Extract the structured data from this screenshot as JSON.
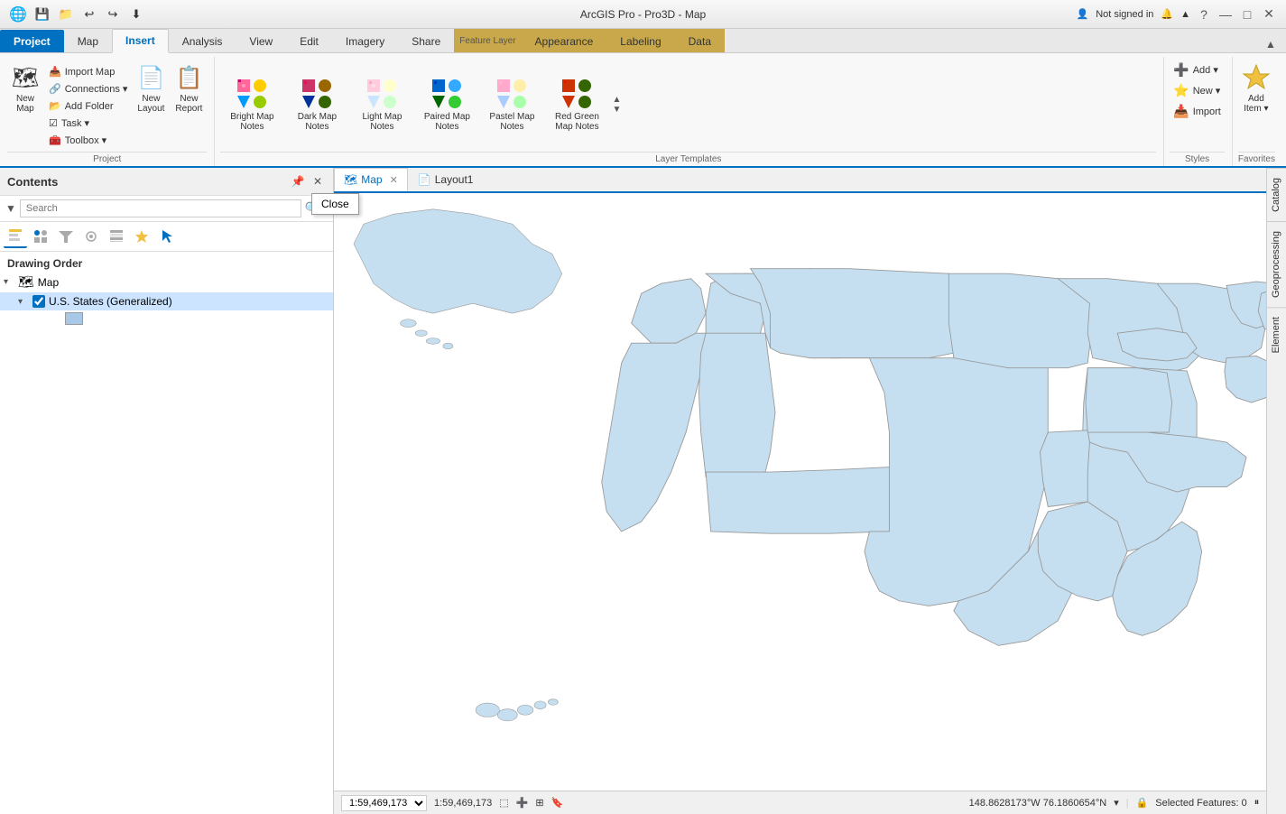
{
  "app": {
    "title": "ArcGIS Pro - Pro3D - Map",
    "feature_layer_title": "Feature Layer"
  },
  "titlebar": {
    "close_btn": "✕",
    "minimize_btn": "—",
    "maximize_btn": "□",
    "help_btn": "?"
  },
  "quickaccess": {
    "btns": [
      "💾",
      "📁",
      "↩",
      "↪",
      "⬇"
    ]
  },
  "ribbon": {
    "tabs": [
      {
        "label": "Project",
        "type": "project"
      },
      {
        "label": "Map",
        "type": "normal"
      },
      {
        "label": "Insert",
        "type": "active"
      },
      {
        "label": "Analysis",
        "type": "normal"
      },
      {
        "label": "View",
        "type": "normal"
      },
      {
        "label": "Edit",
        "type": "normal"
      },
      {
        "label": "Imagery",
        "type": "normal"
      },
      {
        "label": "Share",
        "type": "normal"
      },
      {
        "label": "Appearance",
        "type": "contextual"
      },
      {
        "label": "Labeling",
        "type": "contextual"
      },
      {
        "label": "Data",
        "type": "contextual"
      }
    ],
    "feature_layer_label": "Feature Layer",
    "groups": {
      "project": {
        "label": "Project",
        "items": [
          {
            "label": "New\nMap",
            "icon": "🗺"
          },
          {
            "label": "New\nLayout",
            "icon": "📄"
          },
          {
            "label": "New\nReport",
            "icon": "📋"
          }
        ],
        "small_items": [
          {
            "label": "Import Map"
          },
          {
            "label": "Connections"
          },
          {
            "label": "Add Folder"
          },
          {
            "label": "Task"
          },
          {
            "label": "Toolbox"
          }
        ]
      },
      "layer_templates": {
        "label": "Layer Templates",
        "items": [
          {
            "label": "Bright Map Notes",
            "icon_class": "bright-icon"
          },
          {
            "label": "Dark Map Notes",
            "icon_class": "dark-icon"
          },
          {
            "label": "Light Map Notes",
            "icon_class": "light-icon"
          },
          {
            "label": "Paired Map Notes",
            "icon_class": "paired-icon"
          },
          {
            "label": "Pastel Map Notes",
            "icon_class": "pastel-icon"
          },
          {
            "label": "Red Green Map Notes",
            "icon_class": "redgreen-icon"
          }
        ]
      },
      "styles": {
        "label": "Styles",
        "items": [
          {
            "label": "Add"
          },
          {
            "label": "New"
          },
          {
            "label": "Import"
          }
        ]
      },
      "favorites": {
        "label": "Favorites",
        "items": [
          {
            "label": "Add Item"
          }
        ]
      }
    }
  },
  "contents": {
    "title": "Contents",
    "search_placeholder": "Search",
    "drawing_order_label": "Drawing Order",
    "tree": {
      "root": {
        "label": "Map",
        "expanded": true,
        "children": [
          {
            "label": "U.S. States (Generalized)",
            "checked": true,
            "selected": true,
            "children": [
              {
                "label": "",
                "is_swatch": true
              }
            ]
          }
        ]
      }
    }
  },
  "map_tabs": [
    {
      "label": "Map",
      "closeable": true,
      "active": true,
      "icon": "🗺"
    },
    {
      "label": "Layout1",
      "closeable": false,
      "active": false,
      "icon": "📄"
    }
  ],
  "statusbar": {
    "scale": "1:59,469,173",
    "coordinates": "148.8628173°W  76.1860654°N",
    "selected_features": "Selected Features: 0"
  },
  "tooltip": {
    "label": "Close"
  },
  "right_sidebar_tabs": [
    "Catalog",
    "Geoprocessing",
    "Element"
  ],
  "user": {
    "label": "Not signed in"
  }
}
